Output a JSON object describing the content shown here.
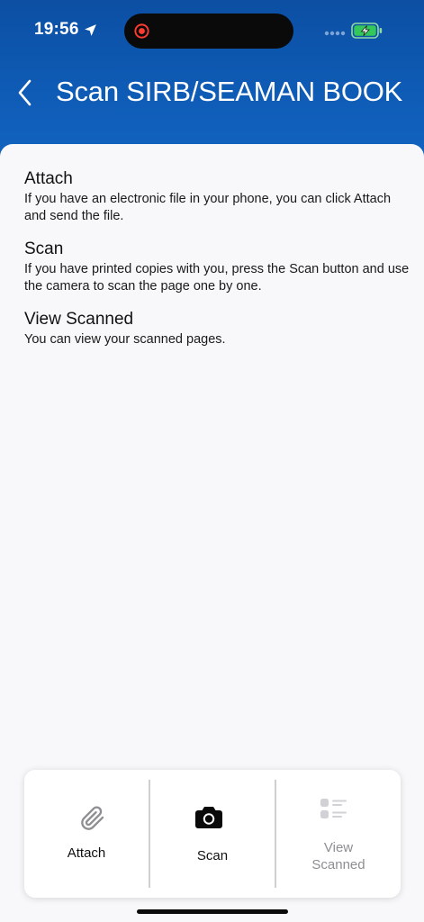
{
  "status_bar": {
    "time": "19:56",
    "icons": [
      "location-arrow-icon",
      "screen-recording-icon",
      "cellular-signal-icon",
      "battery-charging-icon"
    ]
  },
  "header": {
    "title": "Scan SIRB/SEAMAN BOOK",
    "back_icon": "chevron-left-icon"
  },
  "sections": [
    {
      "title": "Attach",
      "text": "If you have an electronic file in your phone, you can click Attach and send the file."
    },
    {
      "title": "Scan",
      "text": "If you have printed copies with you, press the Scan button and use the camera to scan the page one by one."
    },
    {
      "title": "View Scanned",
      "text": "You can view your scanned pages."
    }
  ],
  "actions": {
    "attach": {
      "label": "Attach",
      "icon": "paperclip-icon"
    },
    "scan": {
      "label": "Scan",
      "icon": "camera-icon"
    },
    "view_scanned": {
      "label_line1": "View",
      "label_line2": "Scanned",
      "icon": "list-icon",
      "enabled": false
    }
  },
  "colors": {
    "header_bg": "#0e58b0",
    "content_bg": "#f8f8fa",
    "disabled_text": "#8e8e93",
    "battery_green": "#34c759"
  }
}
